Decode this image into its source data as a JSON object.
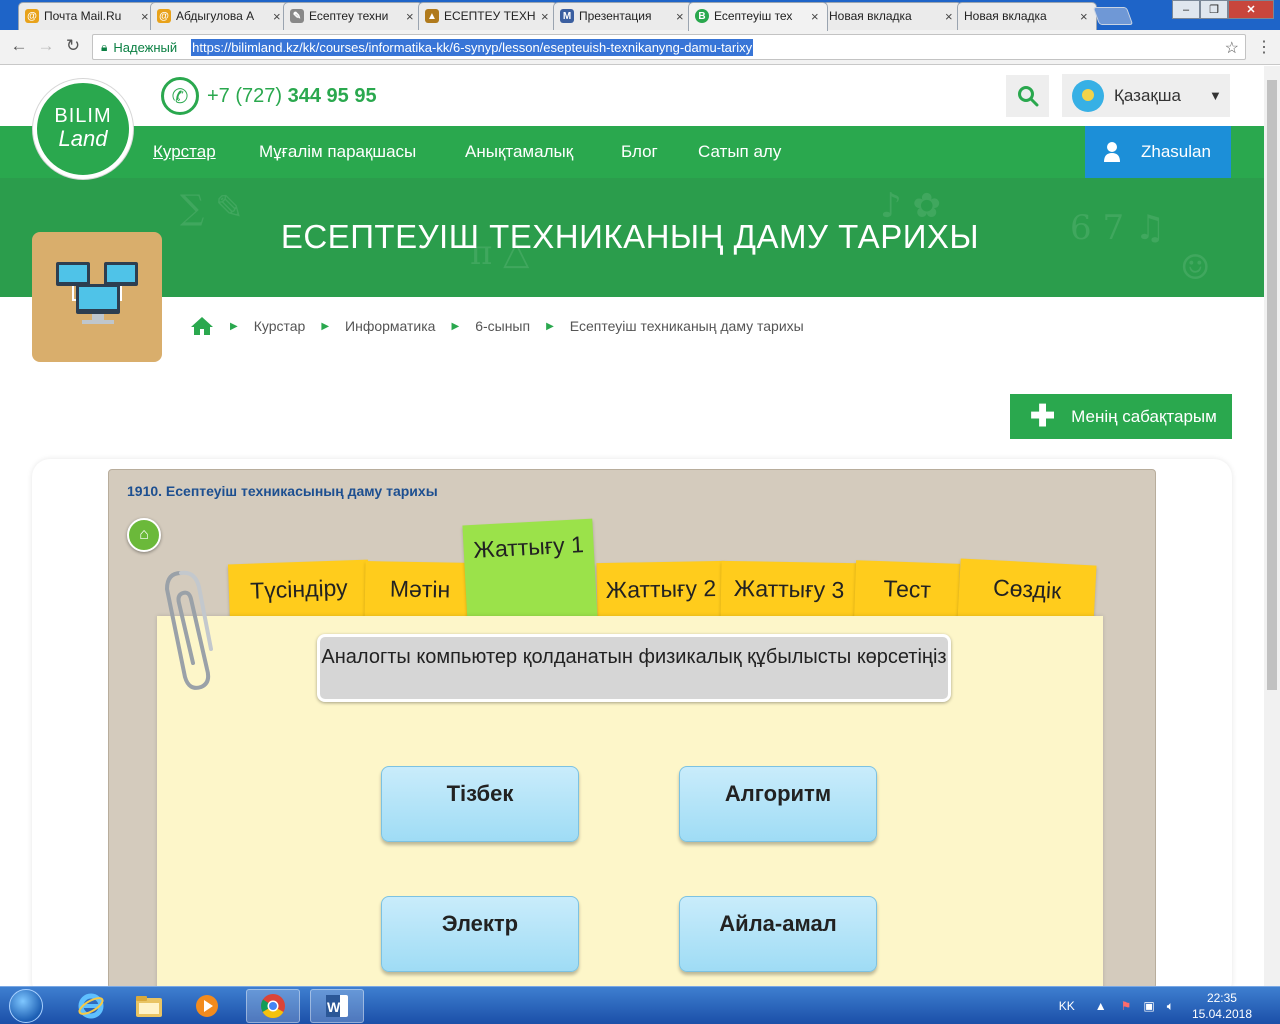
{
  "browser": {
    "tabs": [
      {
        "title": "Почта Mail.Ru",
        "favicon_color": "#e8a21a",
        "favicon": "@"
      },
      {
        "title": "Абдыгулова А",
        "favicon_color": "#e8a21a",
        "favicon": "@"
      },
      {
        "title": "Есептеу техни",
        "favicon_color": "#888888",
        "favicon": "✎"
      },
      {
        "title": "ЕСЕПТЕУ ТЕХН",
        "favicon_color": "#b07a1c",
        "favicon": "▲"
      },
      {
        "title": "Презентация",
        "favicon_color": "#3b5fa0",
        "favicon": "M"
      },
      {
        "title": "Есептеуіш тех",
        "favicon_color": "#2aa84e",
        "favicon": "B",
        "active": true
      },
      {
        "title": "Новая вкладка",
        "favicon_color": "",
        "favicon": ""
      },
      {
        "title": "Новая вкладка",
        "favicon_color": "",
        "favicon": ""
      }
    ],
    "secure_label": "Надежный",
    "url": "https://bilimland.kz/kk/courses/informatika-kk/6-synyp/lesson/esepteuish-texnikanyng-damu-tarixy"
  },
  "site": {
    "logo_line1": "BILIM",
    "logo_line2": "Land",
    "phone_prefix": "+7 (727)",
    "phone_number": "344 95 95",
    "language": "Қазақша",
    "nav": [
      "Курстар",
      "Мұғалім парақшасы",
      "Анықтамалық",
      "Блог",
      "Сатып алу"
    ],
    "user_name": "Zhasulan",
    "page_title": "ЕСЕПТЕУІШ ТЕХНИКАНЫҢ ДАМУ ТАРИХЫ",
    "breadcrumb": [
      "Курстар",
      "Информатика",
      "6-сынып",
      "Есептеуіш техниканың даму тарихы"
    ],
    "my_lessons_label": "Менің сабақтарым"
  },
  "lesson": {
    "title": "1910. Есептеуіш техникасының даму тарихы",
    "tabs": [
      "Түсіндіру",
      "Мәтін",
      "Жаттығу 1",
      "Жаттығу 2",
      "Жаттығу 3",
      "Тест",
      "Сөздік"
    ],
    "active_tab": "Жаттығу 1",
    "question": "Аналогты компьютер қолданатын физикалық құбылысты көрсетіңіз",
    "answers": [
      "Тізбек",
      "Алгоритм",
      "Электр",
      "Айла-амал"
    ]
  },
  "taskbar": {
    "lang": "KK",
    "time": "22:35",
    "date": "15.04.2018"
  },
  "colors": {
    "brand_green": "#2aa84e",
    "user_blue": "#1c8fd8",
    "sticky_yellow": "#ffcc1c",
    "sticky_green": "#9be24a"
  }
}
